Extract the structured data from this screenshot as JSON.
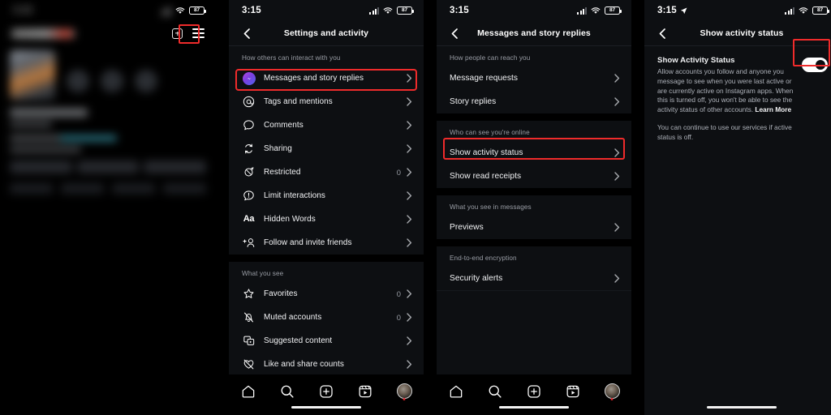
{
  "status_bar": {
    "time": "3:15",
    "battery": "87",
    "signal_icon": "cellular-signal-icon",
    "wifi_icon": "wifi-icon",
    "location_icon": "location-arrow-icon"
  },
  "panel1": {
    "name": "instagram-profile-blurred",
    "plus_icon": "add-post-icon",
    "menu_icon": "hamburger-menu-icon",
    "note": ""
  },
  "panel2": {
    "title": "Settings and activity",
    "back_icon": "chevron-left-icon",
    "sections": [
      {
        "header": "How others can interact with you",
        "items": [
          {
            "label": "Messages and story replies",
            "icon": "messenger-icon",
            "count": "",
            "highlighted": true
          },
          {
            "label": "Tags and mentions",
            "icon": "at-mention-icon",
            "count": ""
          },
          {
            "label": "Comments",
            "icon": "comment-bubble-icon",
            "count": ""
          },
          {
            "label": "Sharing",
            "icon": "sharing-repeat-icon",
            "count": ""
          },
          {
            "label": "Restricted",
            "icon": "restricted-icon",
            "count": "0"
          },
          {
            "label": "Limit interactions",
            "icon": "limit-interactions-icon",
            "count": ""
          },
          {
            "label": "Hidden Words",
            "icon": "hidden-words-aa-icon",
            "count": ""
          },
          {
            "label": "Follow and invite friends",
            "icon": "add-person-icon",
            "count": ""
          }
        ]
      },
      {
        "header": "What you see",
        "items": [
          {
            "label": "Favorites",
            "icon": "star-icon",
            "count": "0"
          },
          {
            "label": "Muted accounts",
            "icon": "muted-bell-icon",
            "count": "0"
          },
          {
            "label": "Suggested content",
            "icon": "suggested-content-icon",
            "count": ""
          },
          {
            "label": "Like and share counts",
            "icon": "hidden-heart-icon",
            "count": ""
          }
        ]
      }
    ]
  },
  "panel3": {
    "title": "Messages and story replies",
    "back_icon": "chevron-left-icon",
    "sections": [
      {
        "header": "How people can reach you",
        "items": [
          {
            "label": "Message requests"
          },
          {
            "label": "Story replies"
          }
        ]
      },
      {
        "header": "Who can see you're online",
        "items": [
          {
            "label": "Show activity status",
            "highlighted": true
          },
          {
            "label": "Show read receipts"
          }
        ]
      },
      {
        "header": "What you see in messages",
        "items": [
          {
            "label": "Previews"
          }
        ]
      },
      {
        "header": "End-to-end encryption",
        "items": [
          {
            "label": "Security alerts"
          }
        ]
      }
    ]
  },
  "panel4": {
    "title": "Show activity status",
    "back_icon": "chevron-left-icon",
    "setting_title": "Show Activity Status",
    "setting_desc": "Allow accounts you follow and anyone you message to see when you were last active or are currently active on Instagram apps. When this is turned off, you won't be able to see the activity status of other accounts. ",
    "learn_more": "Learn More",
    "setting_desc2": "You can continue to use our services if active status is off.",
    "toggle_state": "on",
    "toggle_highlighted": true
  },
  "tab_bar": {
    "items": [
      {
        "icon": "home-icon",
        "name": "tab-home"
      },
      {
        "icon": "search-icon",
        "name": "tab-search"
      },
      {
        "icon": "create-plus-icon",
        "name": "tab-create"
      },
      {
        "icon": "reels-icon",
        "name": "tab-reels"
      },
      {
        "icon": "profile-avatar-icon",
        "name": "tab-profile"
      }
    ]
  },
  "colors": {
    "highlight": "#ef2b2b",
    "panel_bg": "#0d0f12",
    "text_primary": "#f2f3f5",
    "text_secondary": "#9a9ea6"
  }
}
